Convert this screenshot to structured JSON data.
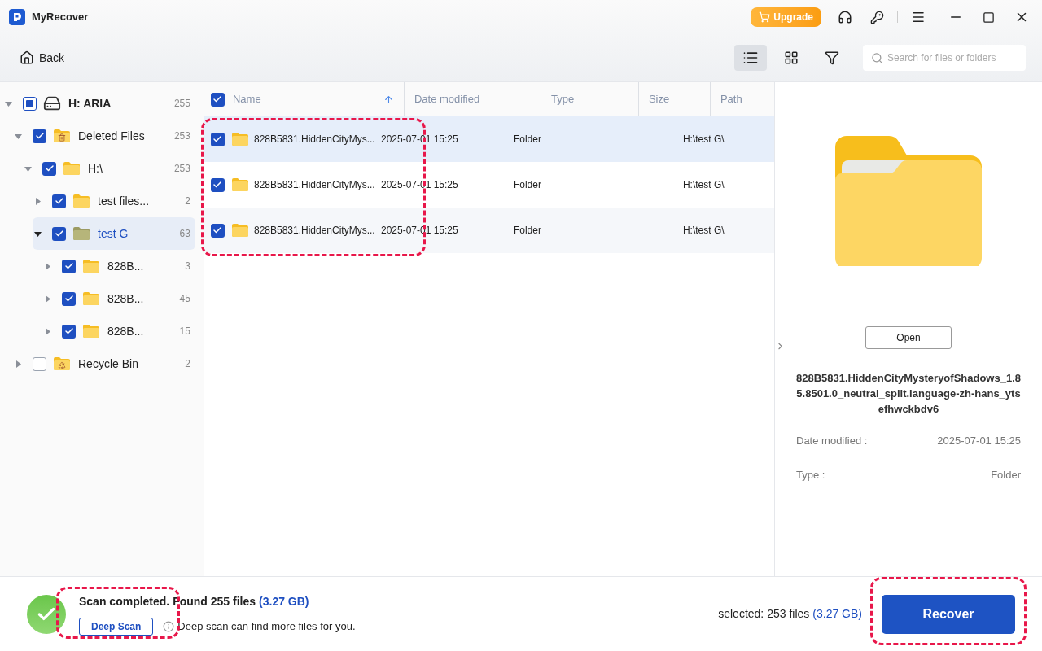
{
  "app": {
    "title": "MyRecover",
    "upgrade": "Upgrade"
  },
  "toolbar": {
    "back": "Back",
    "views": [
      {
        "kind": "list",
        "selected": true
      },
      {
        "kind": "grid",
        "selected": false
      },
      {
        "kind": "filter",
        "selected": false
      }
    ],
    "search": {
      "placeholder": "Search for files or folders"
    }
  },
  "tree": [
    {
      "label": "H: ARIA",
      "count": "255",
      "kind": "drive",
      "checked": false,
      "indeterminate": true,
      "expanded": true,
      "selected": false,
      "children": [
        {
          "label": "Deleted Files",
          "count": "253",
          "kind": "trash",
          "checked": true,
          "expanded": true,
          "selected": false,
          "children": [
            {
              "label": "H:\\",
              "count": "253",
              "kind": "folder",
              "checked": true,
              "expanded": true,
              "selected": false,
              "children": [
                {
                  "label": "test files...",
                  "count": "2",
                  "kind": "folder",
                  "checked": true,
                  "expanded": false,
                  "selected": false
                },
                {
                  "label": "test G",
                  "count": "63",
                  "kind": "folder",
                  "checked": true,
                  "expanded": true,
                  "selected": true,
                  "children": [
                    {
                      "label": "828B...",
                      "count": "3",
                      "kind": "folder",
                      "checked": true,
                      "expanded": false,
                      "selected": false
                    },
                    {
                      "label": "828B...",
                      "count": "45",
                      "kind": "folder",
                      "checked": true,
                      "expanded": false,
                      "selected": false
                    },
                    {
                      "label": "828B...",
                      "count": "15",
                      "kind": "folder",
                      "checked": true,
                      "expanded": false,
                      "selected": false
                    }
                  ]
                }
              ]
            }
          ]
        },
        {
          "label": "Recycle Bin",
          "count": "2",
          "kind": "recycle",
          "checked": false,
          "expanded": false,
          "selected": false
        }
      ]
    }
  ],
  "table": {
    "all_checked": true,
    "columns": [
      {
        "label": "Name",
        "sorted": true
      },
      {
        "label": "Date modified",
        "sorted": false
      },
      {
        "label": "Type",
        "sorted": false
      },
      {
        "label": "Size",
        "sorted": false
      },
      {
        "label": "Path",
        "sorted": false
      }
    ],
    "rows": [
      {
        "checked": true,
        "selected": true,
        "name": "828B5831.HiddenCityMys...",
        "date": "2025-07-01 15:25",
        "type": "Folder",
        "path": "H:\\test G\\"
      },
      {
        "checked": true,
        "selected": false,
        "name": "828B5831.HiddenCityMys...",
        "date": "2025-07-01 15:25",
        "type": "Folder",
        "path": "H:\\test G\\"
      },
      {
        "checked": true,
        "selected": false,
        "name": "828B5831.HiddenCityMys...",
        "date": "2025-07-01 15:25",
        "type": "Folder",
        "path": "H:\\test G\\"
      }
    ]
  },
  "detail": {
    "open": "Open",
    "filename": "828B5831.HiddenCityMysteryofShadows_1.85.8501.0_neutral_split.language-zh-hans_ytsefhwckbdv6",
    "meta": [
      {
        "label": "Date modified :",
        "value": "2025-07-01 15:25"
      },
      {
        "label": "Type :",
        "value": "Folder"
      }
    ]
  },
  "footer": {
    "status": "Scan completed. Found 255 files",
    "status_size": "(3.27 GB)",
    "deep_scan": "Deep Scan",
    "hint": "Deep scan can find more files for you.",
    "selected": "selected: 253 files",
    "selected_size": "(3.27 GB)",
    "recover": "Recover"
  },
  "highlights": {
    "rows": true,
    "deep_scan": true,
    "recover": true
  }
}
